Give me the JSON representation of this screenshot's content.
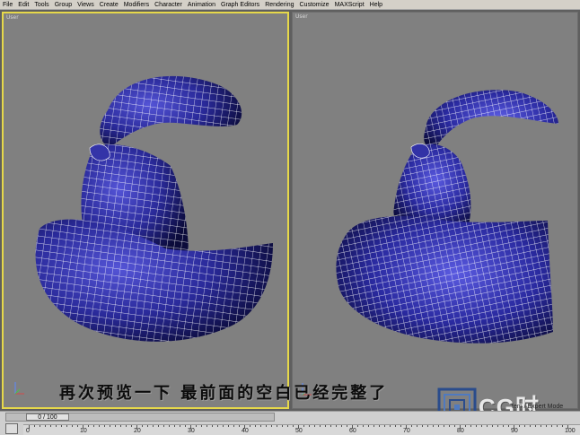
{
  "menu": [
    "File",
    "Edit",
    "Tools",
    "Group",
    "Views",
    "Create",
    "Modifiers",
    "Character",
    "Animation",
    "Graph Editors",
    "Rendering",
    "Customize",
    "MAXScript",
    "Help"
  ],
  "viewports": {
    "left": {
      "label": "User"
    },
    "right": {
      "label": "User"
    }
  },
  "caption": "再次预览一下  最前面的空白已经完整了",
  "logo": {
    "text": "CG时代"
  },
  "status_text": "tem / Expert Mode",
  "timeslider": {
    "current_frame": 0,
    "total_frames": 100,
    "label": "0 / 100"
  },
  "ruler": {
    "labels": [
      "0",
      "10",
      "20",
      "30",
      "40",
      "50",
      "60",
      "70",
      "80",
      "90",
      "100"
    ]
  },
  "colors": {
    "mesh_fill": "#2a2a8a",
    "mesh_wire": "#ffffff",
    "viewport_bg": "#808080",
    "active_border": "#e6d84a"
  }
}
